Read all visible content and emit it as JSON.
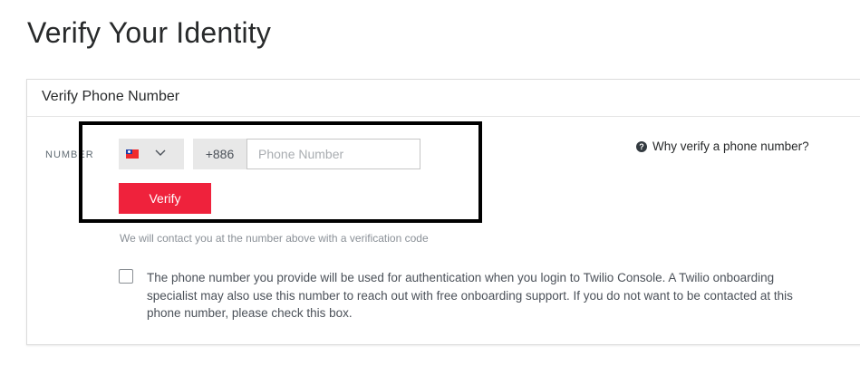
{
  "page": {
    "title": "Verify Your Identity"
  },
  "card": {
    "title": "Verify Phone Number",
    "field_label": "NUMBER",
    "country": {
      "flag_icon": "taiwan-flag-icon",
      "chevron_icon": "chevron-down-icon"
    },
    "dial_code": "+886",
    "phone_input": {
      "value": "",
      "placeholder": "Phone Number"
    },
    "verify_label": "Verify",
    "help_text": "We will contact you at the number above with a verification code",
    "why_link": {
      "icon": "question-circle-icon",
      "label": "Why verify a phone number?"
    },
    "consent": {
      "checked": false,
      "lines": [
        "The phone number you provide will be used for authentication when you login to Twilio Console. A Twilio onboarding",
        "specialist may also use this number to reach out with free onboarding support. If you do not want to be contacted at this",
        "phone number, please check this box."
      ]
    }
  },
  "colors": {
    "accent": "#ef223c",
    "highlight_border": "#000000"
  }
}
